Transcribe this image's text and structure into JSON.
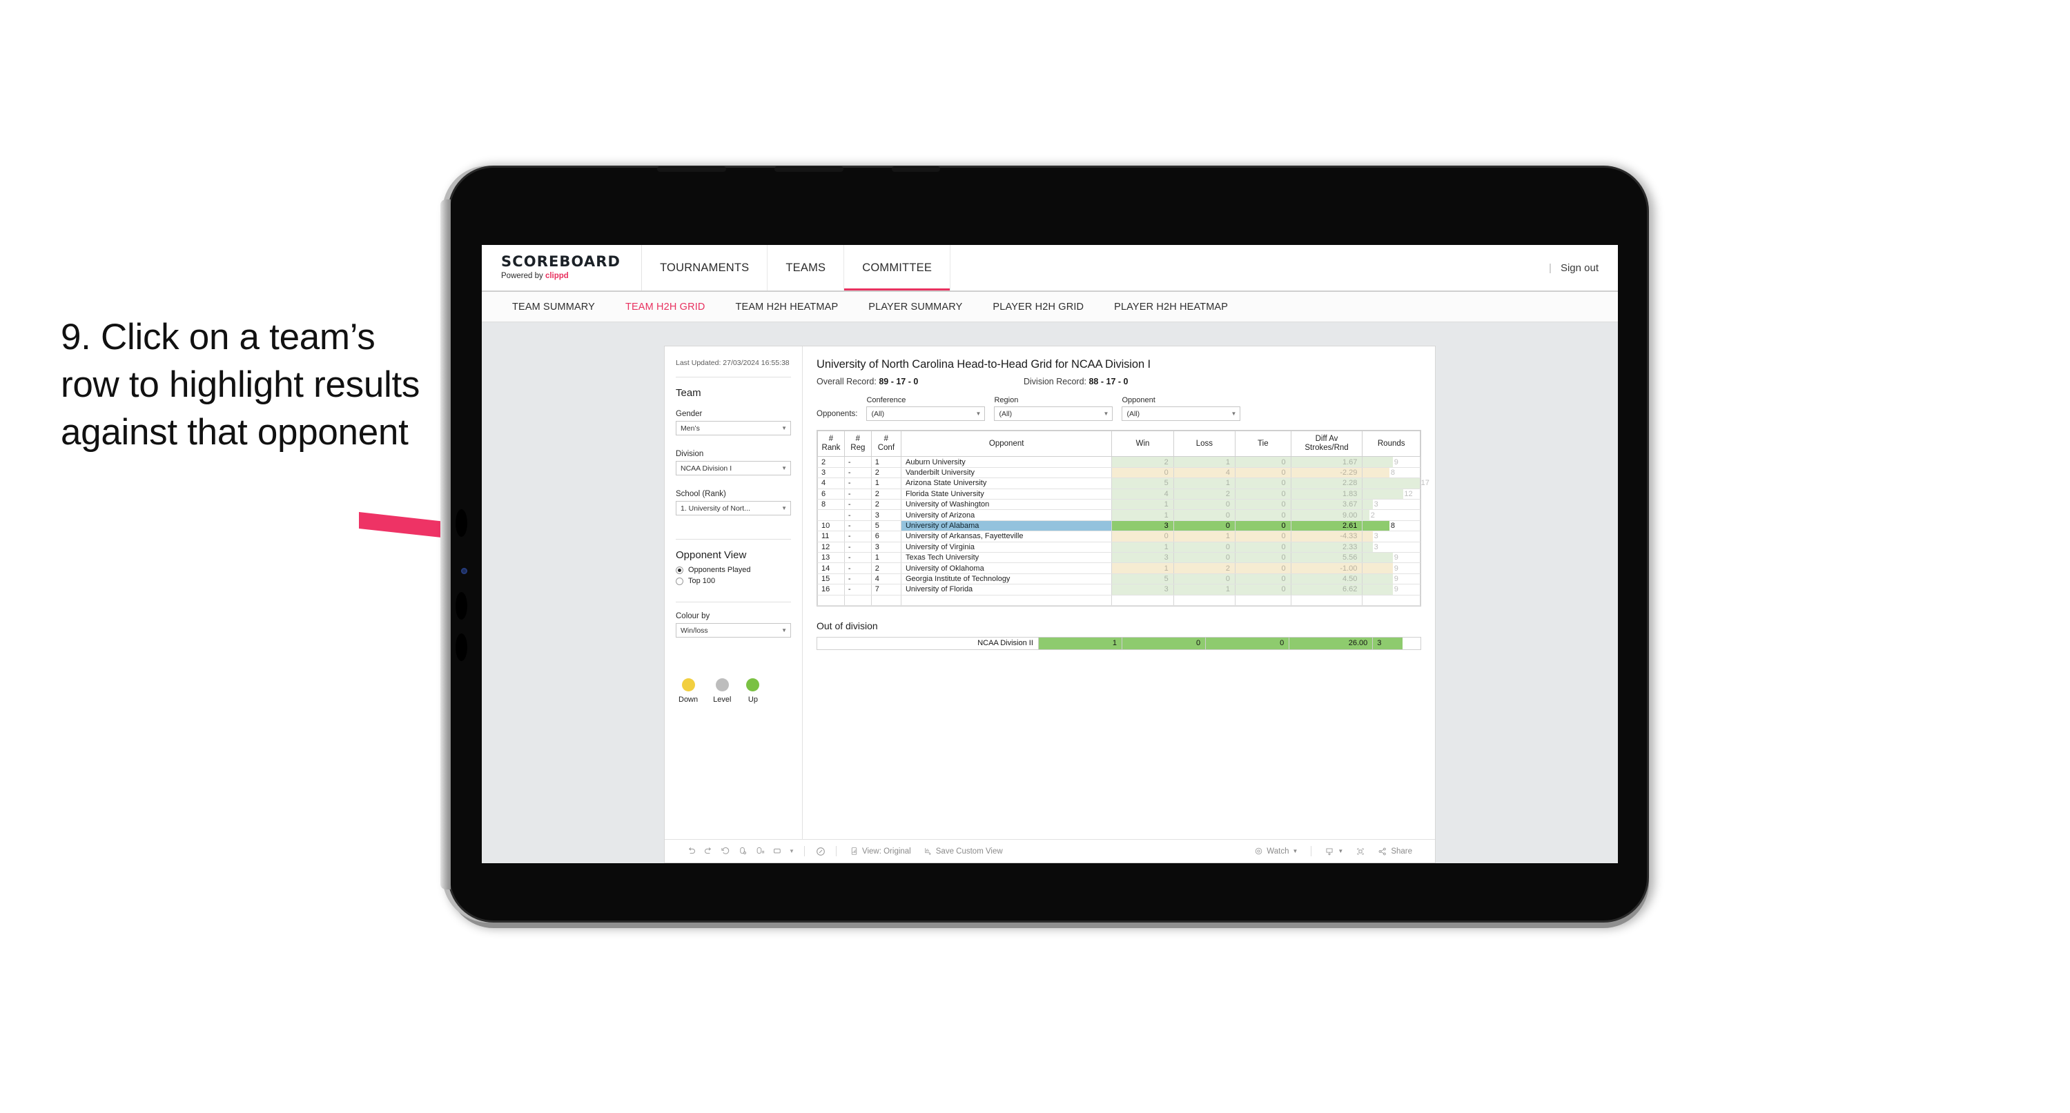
{
  "annotation": {
    "step_text": "9. Click on a team’s row to highlight results against that opponent",
    "arrow_color": "#ee3365"
  },
  "topnav": {
    "brand_name": "SCOREBOARD",
    "brand_sub_prefix": "Powered by ",
    "brand_sub_accent": "clippd",
    "items": [
      {
        "label": "TOURNAMENTS",
        "active": false
      },
      {
        "label": "TEAMS",
        "active": false
      },
      {
        "label": "COMMITTEE",
        "active": true
      }
    ],
    "divider": "|",
    "signout": "Sign out",
    "accent_color": "#e8315f"
  },
  "subnav": {
    "items": [
      {
        "label": "TEAM SUMMARY",
        "active": false
      },
      {
        "label": "TEAM H2H GRID",
        "active": true
      },
      {
        "label": "TEAM H2H HEATMAP",
        "active": false
      },
      {
        "label": "PLAYER SUMMARY",
        "active": false
      },
      {
        "label": "PLAYER H2H GRID",
        "active": false
      },
      {
        "label": "PLAYER H2H HEATMAP",
        "active": false
      }
    ]
  },
  "panel": {
    "last_updated": "Last Updated: 27/03/2024 16:55:38",
    "team_title": "Team",
    "gender": {
      "label": "Gender",
      "value": "Men’s"
    },
    "division": {
      "label": "Division",
      "value": "NCAA Division I"
    },
    "school": {
      "label": "School (Rank)",
      "value": "1. University of Nort..."
    },
    "opponent_view": {
      "title": "Opponent View",
      "options": [
        {
          "label": "Opponents Played",
          "selected": true
        },
        {
          "label": "Top 100",
          "selected": false
        }
      ]
    },
    "colour_by": {
      "label": "Colour by",
      "value": "Win/loss"
    },
    "legend": [
      {
        "label": "Down",
        "color": "#f2cf3f"
      },
      {
        "label": "Level",
        "color": "#bdbdbd"
      },
      {
        "label": "Up",
        "color": "#7ac143"
      }
    ]
  },
  "viz": {
    "title": "University of North Carolina Head-to-Head Grid for NCAA Division I",
    "overall_record_label": "Overall Record: ",
    "overall_record_value": "89 - 17 - 0",
    "division_record_label": "Division Record: ",
    "division_record_value": "88 - 17 - 0",
    "opponents_label": "Opponents:",
    "filters": [
      {
        "label": "Conference",
        "value": "(All)"
      },
      {
        "label": "Region",
        "value": "(All)"
      },
      {
        "label": "Opponent",
        "value": "(All)"
      }
    ]
  },
  "chart_data": {
    "type": "table",
    "title": "University of North Carolina Head-to-Head Grid for NCAA Division I",
    "columns": [
      "# Rank",
      "# Reg",
      "# Conf",
      "Opponent",
      "Win",
      "Loss",
      "Tie",
      "Diff Av Strokes/Rnd",
      "Rounds"
    ],
    "header_lines": {
      "rank": [
        "#",
        "Rank"
      ],
      "reg": [
        "#",
        "Reg"
      ],
      "conf": [
        "#",
        "Conf"
      ],
      "opponent": [
        "Opponent"
      ],
      "win": [
        "Win"
      ],
      "loss": [
        "Loss"
      ],
      "tie": [
        "Tie"
      ],
      "diff": [
        "Diff Av",
        "Strokes/Rnd"
      ],
      "rounds": [
        "Rounds"
      ]
    },
    "selected_row": "University of Alabama",
    "max_rounds": 17,
    "rows": [
      {
        "rank": "2",
        "reg": "-",
        "conf": "1",
        "opponent": "Auburn University",
        "win": "2",
        "loss": "1",
        "tie": "0",
        "diff": "1.67",
        "rounds": "9",
        "tone": "up",
        "selected": false
      },
      {
        "rank": "3",
        "reg": "-",
        "conf": "2",
        "opponent": "Vanderbilt University",
        "win": "0",
        "loss": "4",
        "tie": "0",
        "diff": "-2.29",
        "rounds": "8",
        "tone": "down",
        "selected": false
      },
      {
        "rank": "4",
        "reg": "-",
        "conf": "1",
        "opponent": "Arizona State University",
        "win": "5",
        "loss": "1",
        "tie": "0",
        "diff": "2.28",
        "rounds": "17",
        "tone": "up",
        "selected": false
      },
      {
        "rank": "6",
        "reg": "-",
        "conf": "2",
        "opponent": "Florida State University",
        "win": "4",
        "loss": "2",
        "tie": "0",
        "diff": "1.83",
        "rounds": "12",
        "tone": "up",
        "selected": false
      },
      {
        "rank": "8",
        "reg": "-",
        "conf": "2",
        "opponent": "University of Washington",
        "win": "1",
        "loss": "0",
        "tie": "0",
        "diff": "3.67",
        "rounds": "3",
        "tone": "up",
        "selected": false
      },
      {
        "rank": "",
        "reg": "-",
        "conf": "3",
        "opponent": "University of Arizona",
        "win": "1",
        "loss": "0",
        "tie": "0",
        "diff": "9.00",
        "rounds": "2",
        "tone": "up",
        "selected": false
      },
      {
        "rank": "10",
        "reg": "-",
        "conf": "5",
        "opponent": "University of Alabama",
        "win": "3",
        "loss": "0",
        "tie": "0",
        "diff": "2.61",
        "rounds": "8",
        "tone": "up",
        "selected": true
      },
      {
        "rank": "11",
        "reg": "-",
        "conf": "6",
        "opponent": "University of Arkansas, Fayetteville",
        "win": "0",
        "loss": "1",
        "tie": "0",
        "diff": "-4.33",
        "rounds": "3",
        "tone": "down",
        "selected": false
      },
      {
        "rank": "12",
        "reg": "-",
        "conf": "3",
        "opponent": "University of Virginia",
        "win": "1",
        "loss": "0",
        "tie": "0",
        "diff": "2.33",
        "rounds": "3",
        "tone": "up",
        "selected": false
      },
      {
        "rank": "13",
        "reg": "-",
        "conf": "1",
        "opponent": "Texas Tech University",
        "win": "3",
        "loss": "0",
        "tie": "0",
        "diff": "5.56",
        "rounds": "9",
        "tone": "up",
        "selected": false
      },
      {
        "rank": "14",
        "reg": "-",
        "conf": "2",
        "opponent": "University of Oklahoma",
        "win": "1",
        "loss": "2",
        "tie": "0",
        "diff": "-1.00",
        "rounds": "9",
        "tone": "down",
        "selected": false
      },
      {
        "rank": "15",
        "reg": "-",
        "conf": "4",
        "opponent": "Georgia Institute of Technology",
        "win": "5",
        "loss": "0",
        "tie": "0",
        "diff": "4.50",
        "rounds": "9",
        "tone": "up",
        "selected": false
      },
      {
        "rank": "16",
        "reg": "-",
        "conf": "7",
        "opponent": "University of Florida",
        "win": "3",
        "loss": "1",
        "tie": "0",
        "diff": "6.62",
        "rounds": "9",
        "tone": "up",
        "selected": false
      }
    ],
    "out_of_division": {
      "title": "Out of division",
      "row": {
        "name": "NCAA Division II",
        "win": "1",
        "loss": "0",
        "tie": "0",
        "diff": "26.00",
        "rounds": "3"
      }
    }
  },
  "toolbar": {
    "icons": [
      "undo-icon",
      "redo-icon",
      "revert-icon",
      "refresh-icon",
      "pause-icon",
      "dashboard-icon",
      "chevron-down-icon"
    ],
    "alerts_icon": "alerts-icon",
    "view_original": "View: Original",
    "save_custom_view": "Save Custom View",
    "watch": "Watch",
    "download_icon": "download-icon",
    "fullscreen_icon": "fullscreen-icon",
    "share": "Share"
  }
}
